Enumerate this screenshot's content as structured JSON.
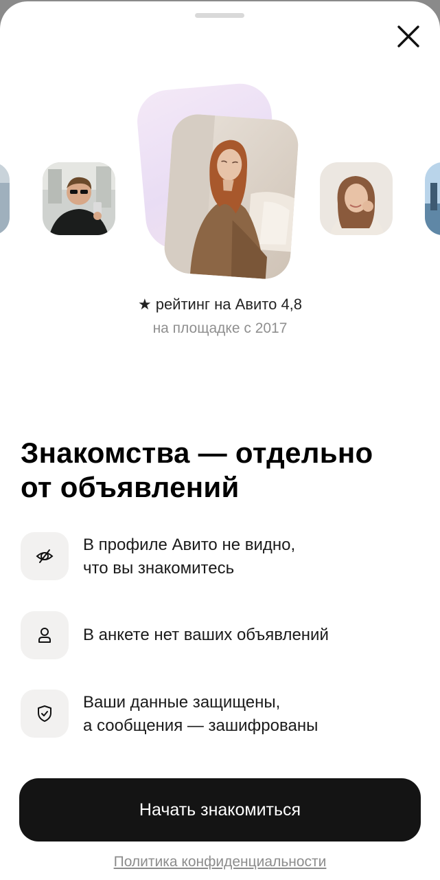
{
  "sheet": {
    "close_icon": "close-icon"
  },
  "profile": {
    "rating_label": "рейтинг на Авито 4,8",
    "since_label": "на площадке с 2017",
    "star_icon": "star-icon"
  },
  "intro": {
    "title": "Знакомства — отдельно\nот объявлений"
  },
  "features": [
    {
      "icon": "eye-off-icon",
      "text": "В профиле Авито не видно,\nчто вы знакомитесь"
    },
    {
      "icon": "person-icon",
      "text": "В анкете нет ваших объявлений"
    },
    {
      "icon": "shield-check-icon",
      "text": "Ваши данные защищены,\nа сообщения — зашифрованы"
    }
  ],
  "actions": {
    "start_label": "Начать знакомиться",
    "privacy_label": "Политика конфиденциальности"
  },
  "colors": {
    "button_bg": "#141414",
    "icon_tile_bg": "#f2f1f0",
    "secondary_text": "#8f8f8f"
  }
}
